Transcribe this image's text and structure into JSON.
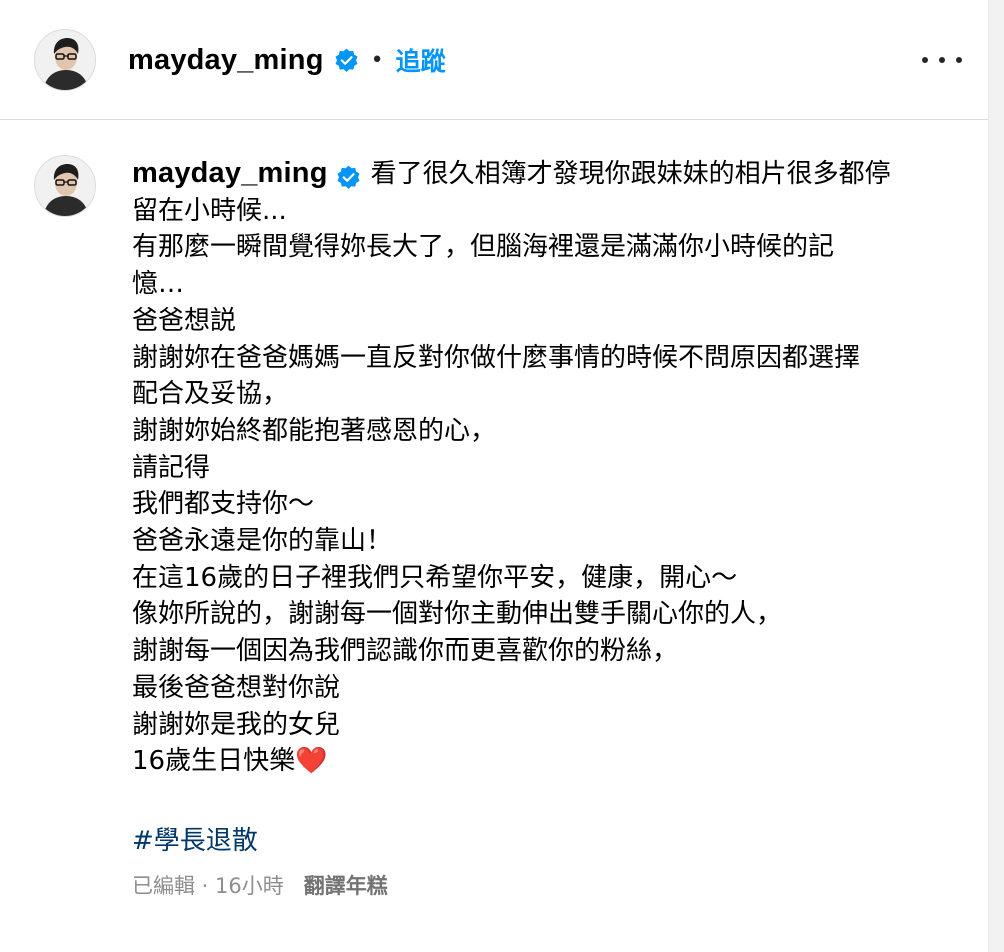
{
  "header": {
    "username": "mayday_ming",
    "separator": "•",
    "follow_label": "追蹤"
  },
  "caption": {
    "username": "mayday_ming",
    "lines": [
      "看了很久相簿才發現你跟妹妹的相片很多都停",
      "留在小時候...",
      "有那麼一瞬間覺得妳長大了，但腦海裡還是滿滿你小時候的記",
      "憶…",
      "爸爸想説",
      "謝謝妳在爸爸媽媽一直反對你做什麼事情的時候不問原因都選擇",
      "配合及妥協，",
      "謝謝妳始終都能抱著感恩的心，",
      "請記得",
      "我們都支持你～",
      "爸爸永遠是你的靠山！",
      "在這16歲的日子裡我們只希望你平安，健康，開心～",
      "像妳所說的，謝謝每一個對你主動伸出雙手關心你的人，",
      "謝謝每一個因為我們認識你而更喜歡你的粉絲，",
      "最後爸爸想對你說",
      "謝謝妳是我的女兒",
      "16歲生日快樂"
    ],
    "heart": "❤️",
    "hashtag": "#學長退散"
  },
  "meta": {
    "edited_time": "已編輯 · 16小時",
    "translate_label": "翻譯年糕"
  },
  "colors": {
    "follow": "#0095f6",
    "hashtag": "#00376b",
    "verified": "#0095f6",
    "meta_text": "#8e8e8e"
  },
  "icons": {
    "verified": "verified-badge-icon",
    "more": "more-options-icon"
  }
}
